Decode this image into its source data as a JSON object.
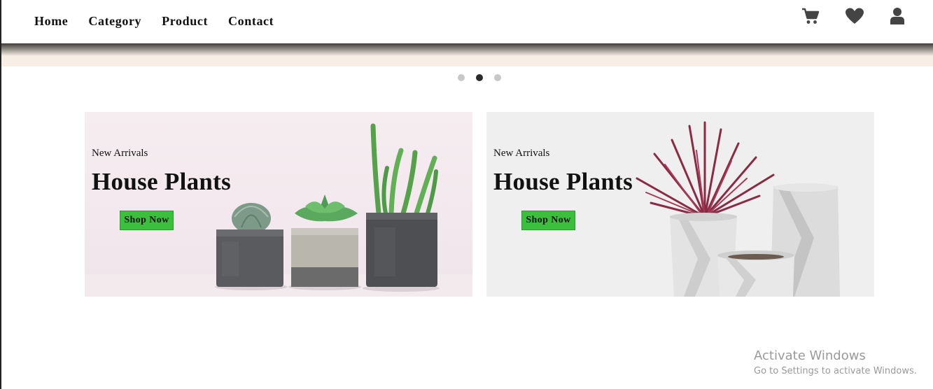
{
  "nav": {
    "links": [
      "Home",
      "Category",
      "Product",
      "Contact"
    ],
    "icons": [
      "cart-icon",
      "heart-icon",
      "user-icon"
    ]
  },
  "carousel": {
    "count": 3,
    "active_index": 1
  },
  "banners": [
    {
      "subtitle": "New Arrivals",
      "title": "House Plants",
      "button": "Shop Now",
      "image": "succulents-in-concrete-pots"
    },
    {
      "subtitle": "New Arrivals",
      "title": "House Plants",
      "button": "Shop Now",
      "image": "red-plant-in-white-geometric-vases"
    }
  ],
  "watermark": {
    "title": "Activate Windows",
    "subtitle": "Go to Settings to activate Windows."
  },
  "colors": {
    "button": "#3cbf3c",
    "banner_left_bg": "#f4eaee",
    "banner_right_bg": "#efefef",
    "active_dot": "#2b2b2b"
  }
}
